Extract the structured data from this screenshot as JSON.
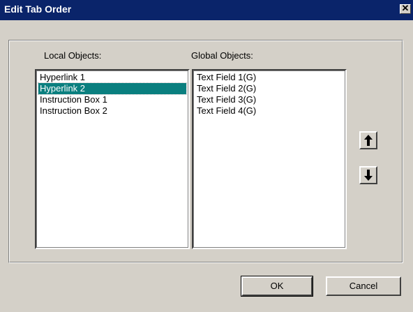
{
  "window": {
    "title": "Edit Tab Order",
    "close_glyph": "✕",
    "close_icon": "close-icon"
  },
  "local_objects": {
    "label": "Local  Objects:",
    "items": [
      "Hyperlink 1",
      "Hyperlink 2",
      "Instruction Box 1",
      "Instruction Box 2"
    ],
    "selected_item": "Hyperlink 2"
  },
  "global_objects": {
    "label": "Global Objects:",
    "items": [
      "Text Field 1(G)",
      "Text Field 2(G)",
      "Text Field 3(G)",
      "Text Field 4(G)"
    ]
  },
  "move_buttons": {
    "up_icon": "arrow-up-icon",
    "down_icon": "arrow-down-icon"
  },
  "actions": {
    "ok_label": "OK",
    "cancel_label": "Cancel"
  },
  "colors": {
    "titlebar": "#0a246a",
    "selection": "#0a7f7f",
    "face": "#d4d0c8"
  }
}
